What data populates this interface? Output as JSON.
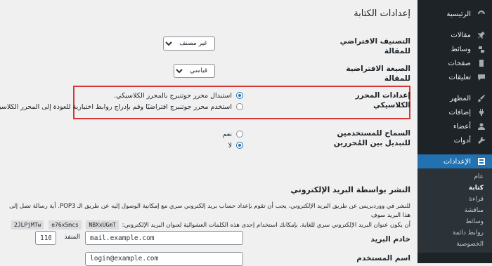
{
  "sidebar": {
    "items": [
      {
        "label": "الرئيسية",
        "icon": "dashboard-icon"
      },
      {
        "label": "مقالات",
        "icon": "pin-icon"
      },
      {
        "label": "وسائط",
        "icon": "media-icon"
      },
      {
        "label": "صفحات",
        "icon": "page-icon"
      },
      {
        "label": "تعليقات",
        "icon": "comment-icon"
      },
      {
        "label": "المظهر",
        "icon": "brush-icon"
      },
      {
        "label": "إضافات",
        "icon": "plugin-icon"
      },
      {
        "label": "أعضاء",
        "icon": "user-icon"
      },
      {
        "label": "أدوات",
        "icon": "wrench-icon"
      },
      {
        "label": "الإعدادات",
        "icon": "settings-icon"
      }
    ],
    "submenu": [
      "عام",
      "كتابة",
      "قراءة",
      "مناقشة",
      "وسائط",
      "روابط دائمة",
      "الخصوصية"
    ],
    "current_sub": "كتابة"
  },
  "page": {
    "title": "إعدادات الكتابة"
  },
  "default_category": {
    "label": "التصنيف الافتراضي للمقالة",
    "value": "غير مصنف"
  },
  "default_format": {
    "label": "الصيغة الافتراضية للمقالة",
    "value": "قياسي"
  },
  "classic_editor": {
    "label": "إعدادات المحرر الكلاسيكي",
    "option1": "استبدال محرر جوتنبرج بالمحرر الكلاسيكي.",
    "option2": "استخدم محرر جوتنبرج افتراضيًا وقم بإدراج روابط اختيارية للعودة إلى المحرر الكلاسيكي."
  },
  "allow_switch": {
    "label": "السماح للمستخدمين للتبديل بين المُحررين",
    "yes": "نعم",
    "no": "لا"
  },
  "email_post": {
    "heading": "النشر بواسطة البريد الإلكتروني",
    "para_line1": "للنشر في ووردبريس عن طريق البريد الإلكتروني، يجب أن تقوم بإعداد حساب بريد إلكتروني سري مع إمكانية الوصول إليه عن طريق الـ POP3. أية رسالة تصل إلى هذا البريد سوف",
    "para_line2": "أن يكون عنوان البريد الإلكتروني سري للغاية. بإمكانك استخدام إحدى هذه الكلمات العشوائية لعنوان البريد الإلكتروني:",
    "codes": [
      "2JLPjMTw",
      "e76x5mcs",
      "NBXxUGmT"
    ]
  },
  "mail_server": {
    "label": "خادم البريد",
    "value": "mail.example.com",
    "port_label": "المنفذ",
    "port": "110"
  },
  "login_name": {
    "label": "اسم المستخدم",
    "value": "login@example.com"
  }
}
